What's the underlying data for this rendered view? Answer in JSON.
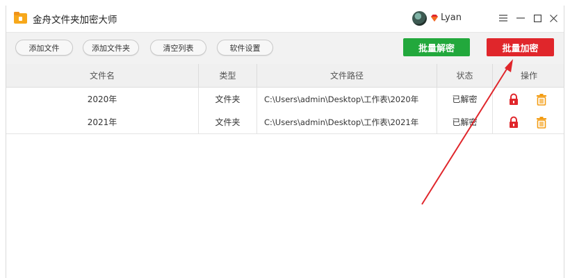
{
  "app": {
    "title": "金舟文件夹加密大师",
    "logo_icon": "folder-icon"
  },
  "user": {
    "name": "Lyan",
    "vip_icon": "vip-gem-icon"
  },
  "window_controls": [
    "menu-icon",
    "minimize-icon",
    "maximize-icon",
    "close-icon"
  ],
  "toolbar": {
    "add_file": "添加文件",
    "add_folder": "添加文件夹",
    "clear_list": "清空列表",
    "settings": "软件设置",
    "batch_decrypt": "批量解密",
    "batch_encrypt": "批量加密"
  },
  "colors": {
    "decrypt": "#22a83c",
    "encrypt": "#e0262b",
    "lock": "#e0262b",
    "delete": "#f39c12",
    "annotation_arrow": "#e0262b"
  },
  "table": {
    "headers": [
      "文件名",
      "类型",
      "文件路径",
      "状态",
      "操作"
    ],
    "rows": [
      {
        "name": "2020年",
        "type": "文件夹",
        "path": "C:\\Users\\admin\\Desktop\\工作表\\2020年",
        "status": "已解密"
      },
      {
        "name": "2021年",
        "type": "文件夹",
        "path": "C:\\Users\\admin\\Desktop\\工作表\\2021年",
        "status": "已解密"
      }
    ]
  }
}
